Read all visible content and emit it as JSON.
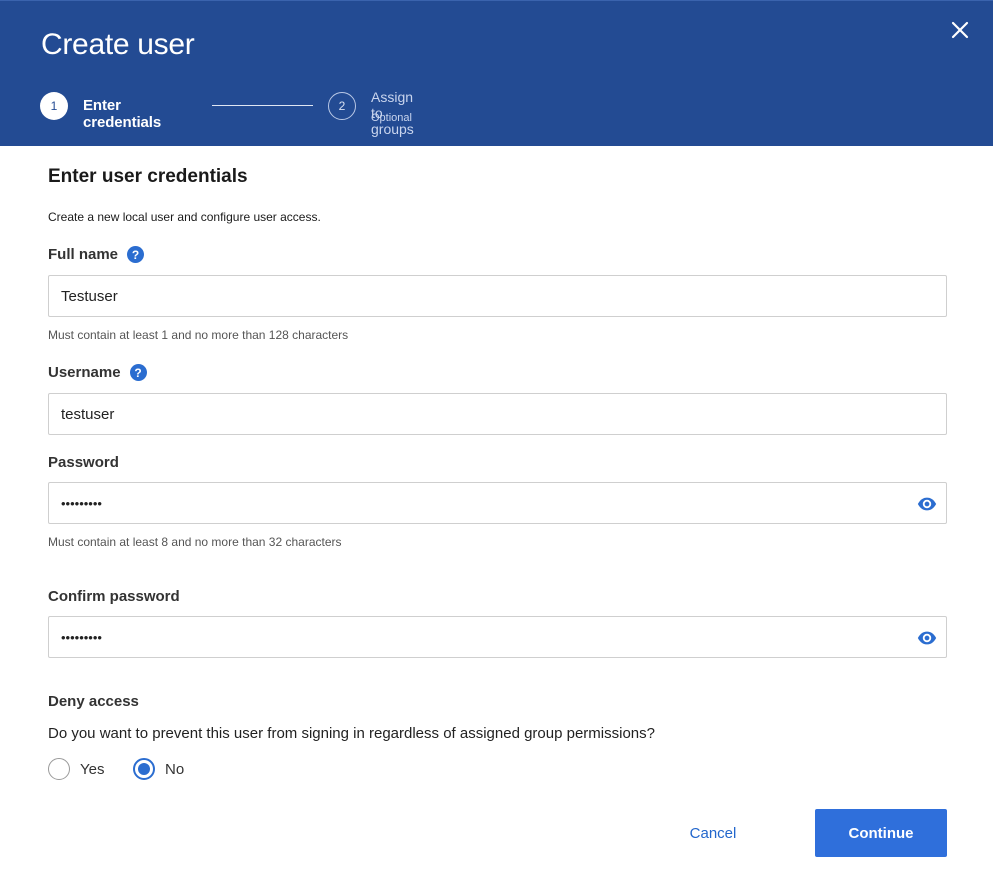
{
  "modal": {
    "title": "Create user",
    "close_icon": "close-icon"
  },
  "stepper": {
    "steps": [
      {
        "number": "1",
        "label": "Enter credentials",
        "sublabel": "",
        "state": "active"
      },
      {
        "number": "2",
        "label": "Assign to groups",
        "sublabel": "Optional",
        "state": "inactive"
      }
    ]
  },
  "form": {
    "section_title": "Enter user credentials",
    "section_description": "Create a new local user and configure user access.",
    "full_name": {
      "label": "Full name",
      "help_icon": "question-circle-icon",
      "value": "Testuser",
      "hint": "Must contain at least 1 and no more than 128 characters"
    },
    "username": {
      "label": "Username",
      "help_icon": "question-circle-icon",
      "value": "testuser"
    },
    "password": {
      "label": "Password",
      "value_masked": "•••••••••",
      "toggle_icon": "eye-icon",
      "hint": "Must contain at least 8 and no more than 32 characters"
    },
    "confirm_password": {
      "label": "Confirm password",
      "value_masked": "•••••••••",
      "toggle_icon": "eye-icon"
    },
    "deny_access": {
      "label": "Deny access",
      "question": "Do you want to prevent this user from signing in regardless of assigned group permissions?",
      "options": [
        {
          "label": "Yes",
          "checked": false
        },
        {
          "label": "No",
          "checked": true
        }
      ]
    }
  },
  "footer": {
    "cancel_label": "Cancel",
    "continue_label": "Continue"
  },
  "colors": {
    "header_bg": "#234b93",
    "primary": "#2f6fdb",
    "link": "#2266cc"
  }
}
